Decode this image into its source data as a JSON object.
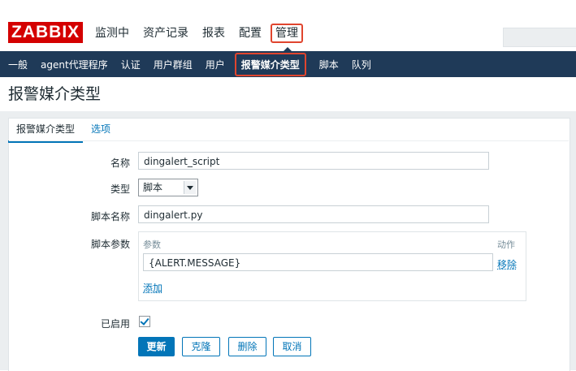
{
  "header": {
    "logo": "ZABBIX",
    "nav": [
      "监测中",
      "资产记录",
      "报表",
      "配置"
    ],
    "nav_active": "管理"
  },
  "subnav": {
    "items": [
      "一般",
      "agent代理程序",
      "认证",
      "用户群组",
      "用户"
    ],
    "active": "报警媒介类型",
    "items_after": [
      "脚本",
      "队列"
    ]
  },
  "page": {
    "title": "报警媒介类型"
  },
  "tabs": {
    "active": "报警媒介类型",
    "other": "选项"
  },
  "form": {
    "name_label": "名称",
    "name_value": "dingalert_script",
    "type_label": "类型",
    "type_value": "脚本",
    "script_name_label": "脚本名称",
    "script_name_value": "dingalert.py",
    "script_params_label": "脚本参数",
    "params_header": "参数",
    "action_header": "动作",
    "param_value": "{ALERT.MESSAGE}",
    "remove_label": "移除",
    "add_label": "添加",
    "enabled_label": "已启用",
    "enabled": true
  },
  "buttons": {
    "update": "更新",
    "clone": "克隆",
    "delete": "删除",
    "cancel": "取消"
  },
  "colors": {
    "brand_red": "#d40000",
    "nav_dark": "#1f3a58",
    "accent_blue": "#0275b8",
    "highlight": "#e0452e"
  }
}
